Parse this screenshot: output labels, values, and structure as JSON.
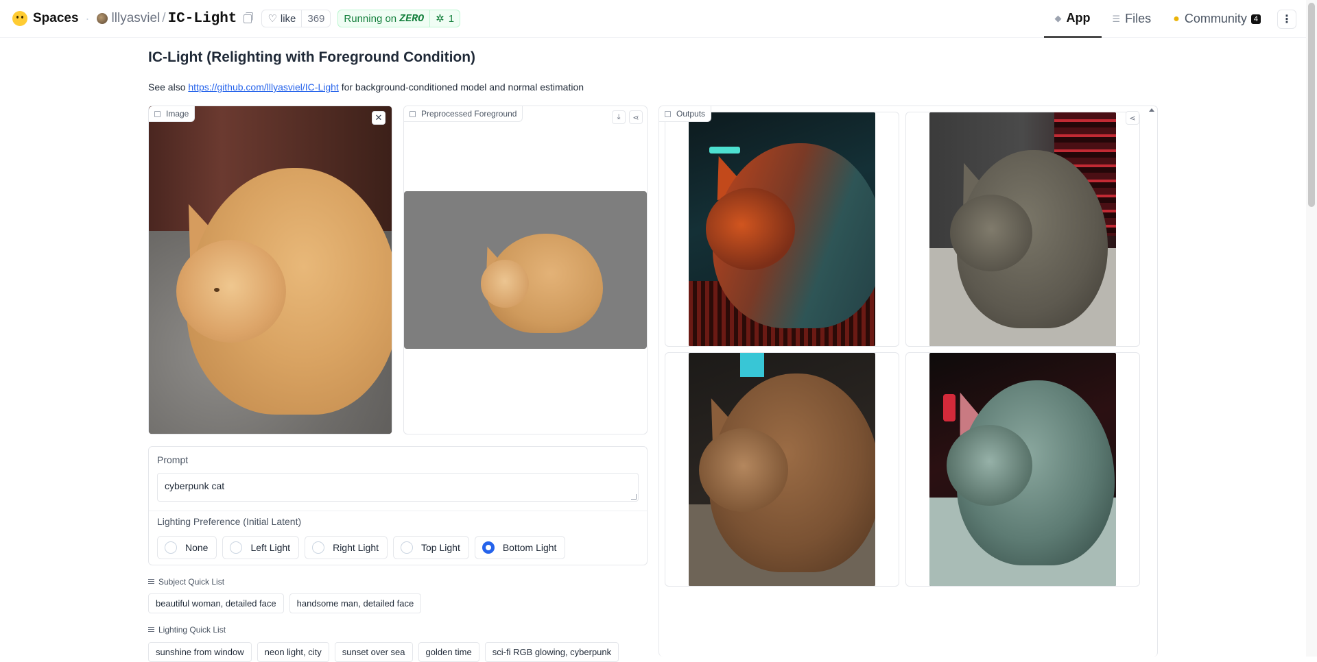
{
  "topbar": {
    "brand": "Spaces",
    "owner": "lllyasviel",
    "repo": "IC-Light",
    "like_label": "like",
    "like_count": "369",
    "run_status": "Running on",
    "run_hardware": "ZERO",
    "run_count": "1",
    "nav": [
      {
        "label": "App",
        "icon": "app-cube-icon"
      },
      {
        "label": "Files",
        "icon": "files-icon"
      },
      {
        "label": "Community",
        "icon": "community-icon",
        "badge": "4"
      }
    ]
  },
  "page": {
    "title": "IC-Light (Relighting with Foreground Condition)",
    "subtitle_pre": "See also ",
    "subtitle_link": "https://github.com/lllyasviel/IC-Light",
    "subtitle_post": " for background-conditioned model and normal estimation"
  },
  "panels": {
    "image_label": "Image",
    "preprocessed_label": "Preprocessed Foreground",
    "outputs_label": "Outputs"
  },
  "form": {
    "prompt_label": "Prompt",
    "prompt_value": "cyberpunk cat",
    "lighting_label": "Lighting Preference (Initial Latent)",
    "lighting_options": [
      "None",
      "Left Light",
      "Right Light",
      "Top Light",
      "Bottom Light"
    ],
    "lighting_selected": "Bottom Light"
  },
  "subject_quick_list": {
    "label": "Subject Quick List",
    "items": [
      "beautiful woman, detailed face",
      "handsome man, detailed face"
    ]
  },
  "lighting_quick_list": {
    "label": "Lighting Quick List",
    "items": [
      "sunshine from window",
      "neon light, city",
      "sunset over sea",
      "golden time",
      "sci-fi RGB glowing, cyberpunk"
    ]
  },
  "colors": {
    "accent": "#2563eb",
    "running_green": "#15803d"
  }
}
